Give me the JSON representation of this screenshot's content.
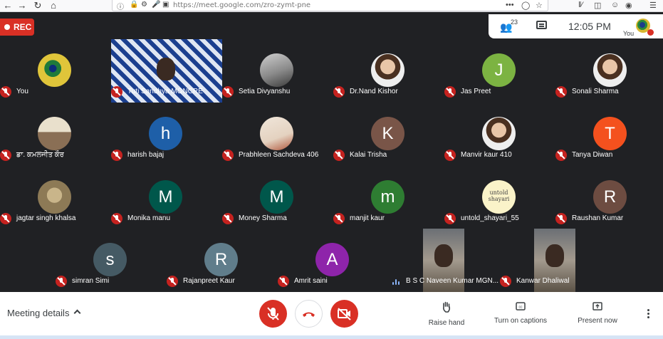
{
  "browser": {
    "url": "https://meet.google.com/zro-zymt-pne"
  },
  "recording": {
    "label": "REC"
  },
  "info": {
    "participant_count": "23",
    "time": "12:05  PM",
    "self_label": "You"
  },
  "participants": [
    {
      "name": "You",
      "kind": "image",
      "image": "peacock-feather"
    },
    {
      "name": "Tuti Sandhya MGNCRE",
      "kind": "video"
    },
    {
      "name": "Setia Divyanshu",
      "kind": "image",
      "image": "silhouette-photo"
    },
    {
      "name": "Dr.Nand Kishor",
      "kind": "image",
      "image": "portrait-photo"
    },
    {
      "name": "Jas Preet",
      "kind": "letter",
      "letter": "J",
      "color": "#7cb342"
    },
    {
      "name": "Sonali Sharma",
      "kind": "image",
      "image": "portrait-photo"
    },
    {
      "name": "ਡਾ. ਕਮਲਜੀਤ ਕੌਰ",
      "kind": "image",
      "image": "group-photo"
    },
    {
      "name": "harish bajaj",
      "kind": "letter",
      "letter": "h",
      "color": "#1e5fa8"
    },
    {
      "name": "Prabhleen Sachdeva 406",
      "kind": "image",
      "image": "sketch-photo"
    },
    {
      "name": "Kalai Trisha",
      "kind": "letter",
      "letter": "K",
      "color": "#795548"
    },
    {
      "name": "Manvir kaur 410",
      "kind": "image",
      "image": "portrait-photo"
    },
    {
      "name": "Tanya Diwan",
      "kind": "letter",
      "letter": "T",
      "color": "#f4511e"
    },
    {
      "name": "jagtar singh khalsa",
      "kind": "image",
      "image": "sepia-photo"
    },
    {
      "name": "Monika manu",
      "kind": "letter",
      "letter": "M",
      "color": "#00574b"
    },
    {
      "name": "Money Sharma",
      "kind": "letter",
      "letter": "M",
      "color": "#00574b"
    },
    {
      "name": "manjit kaur",
      "kind": "letter",
      "letter": "m",
      "color": "#2e7d32"
    },
    {
      "name": "untold_shayari_55",
      "kind": "image",
      "image": "untold-shayari-logo",
      "image_text": "untold shayari"
    },
    {
      "name": "Raushan Kumar",
      "kind": "letter",
      "letter": "R",
      "color": "#6d4c41"
    },
    {
      "name": "simran Simi",
      "kind": "letter",
      "letter": "s",
      "color": "#455a64"
    },
    {
      "name": "Rajanpreet Kaur",
      "kind": "letter",
      "letter": "R",
      "color": "#607d8b"
    },
    {
      "name": "Amrit saini",
      "kind": "letter",
      "letter": "A",
      "color": "#8e24aa"
    },
    {
      "name": "B S C Naveen Kumar MGN...",
      "kind": "video",
      "speaking": true
    },
    {
      "name": "Kanwar Dhaliwal",
      "kind": "video"
    }
  ],
  "controls": {
    "meeting_details": "Meeting details",
    "raise_hand": "Raise hand",
    "captions": "Turn on captions",
    "present_now": "Present now"
  }
}
